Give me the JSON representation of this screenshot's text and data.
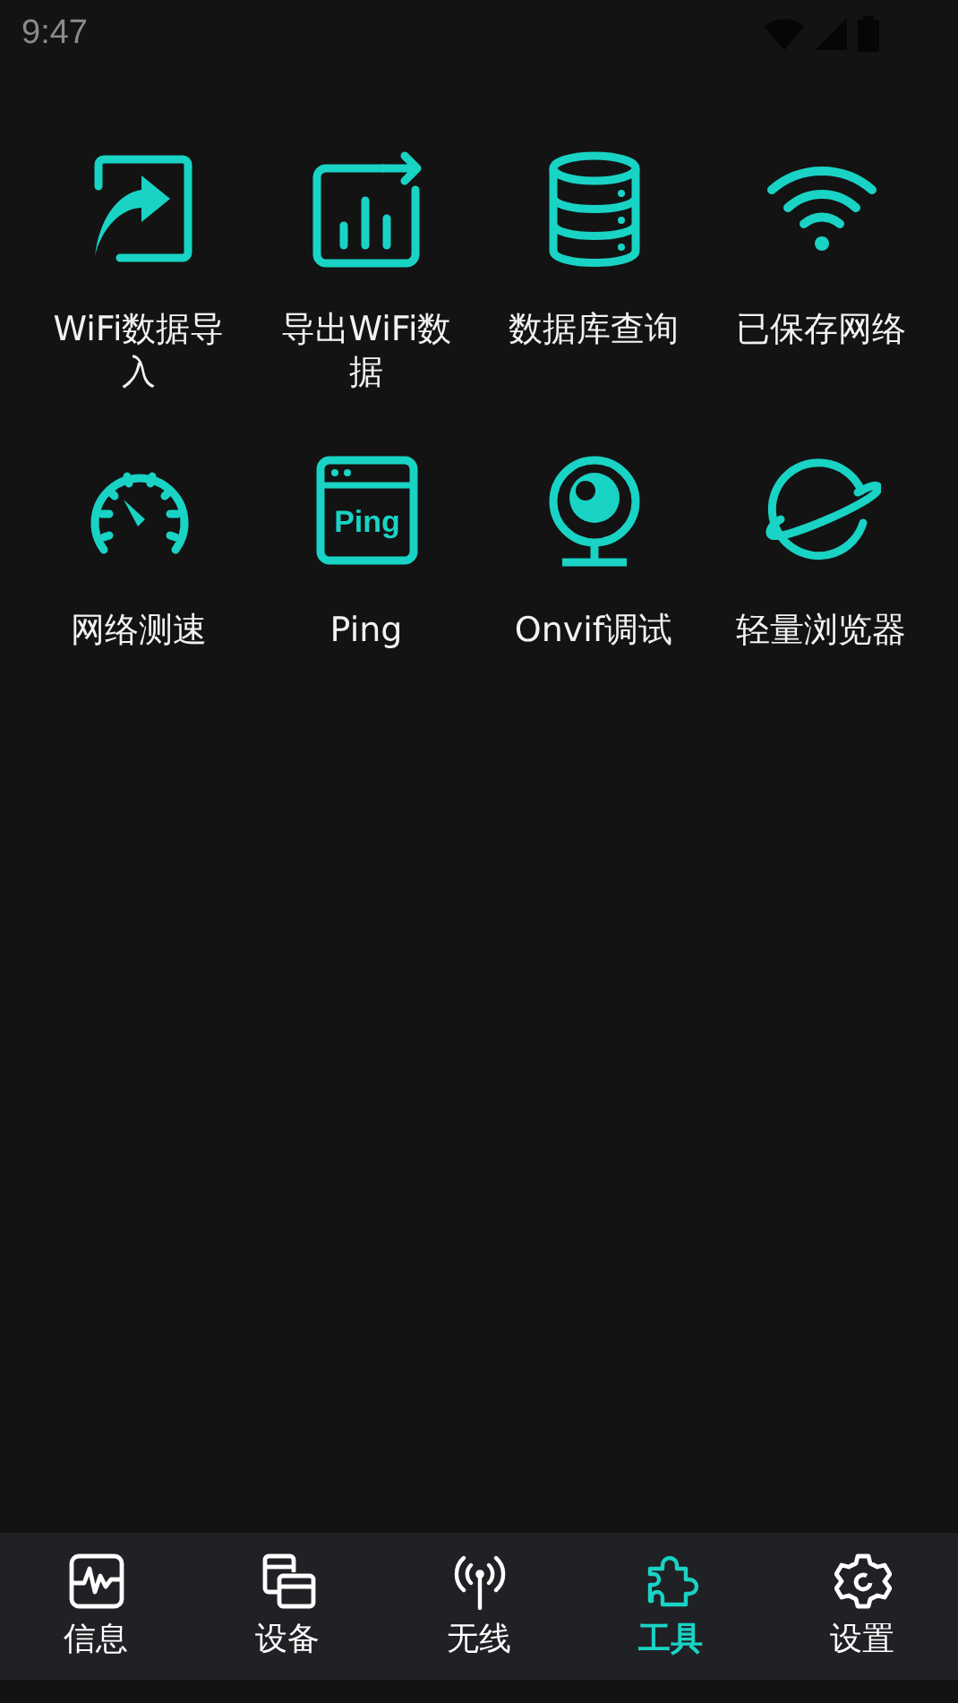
{
  "status_bar": {
    "time": "9:47"
  },
  "tools": [
    {
      "kind": "import",
      "label": "WiFi数据导入"
    },
    {
      "kind": "export",
      "label": "导出WiFi数据"
    },
    {
      "kind": "database",
      "label": "数据库查询"
    },
    {
      "kind": "wifi",
      "label": "已保存网络"
    },
    {
      "kind": "speed",
      "label": "网络测速"
    },
    {
      "kind": "ping",
      "label": "Ping",
      "icon_text": "Ping"
    },
    {
      "kind": "camera",
      "label": "Onvif调试"
    },
    {
      "kind": "planet",
      "label": "轻量浏览器"
    }
  ],
  "nav": [
    {
      "kind": "info",
      "label": "信息",
      "selected": false
    },
    {
      "kind": "devices",
      "label": "设备",
      "selected": false
    },
    {
      "kind": "wireless",
      "label": "无线",
      "selected": false
    },
    {
      "kind": "tools",
      "label": "工具",
      "selected": true
    },
    {
      "kind": "settings",
      "label": "设置",
      "selected": false
    }
  ]
}
